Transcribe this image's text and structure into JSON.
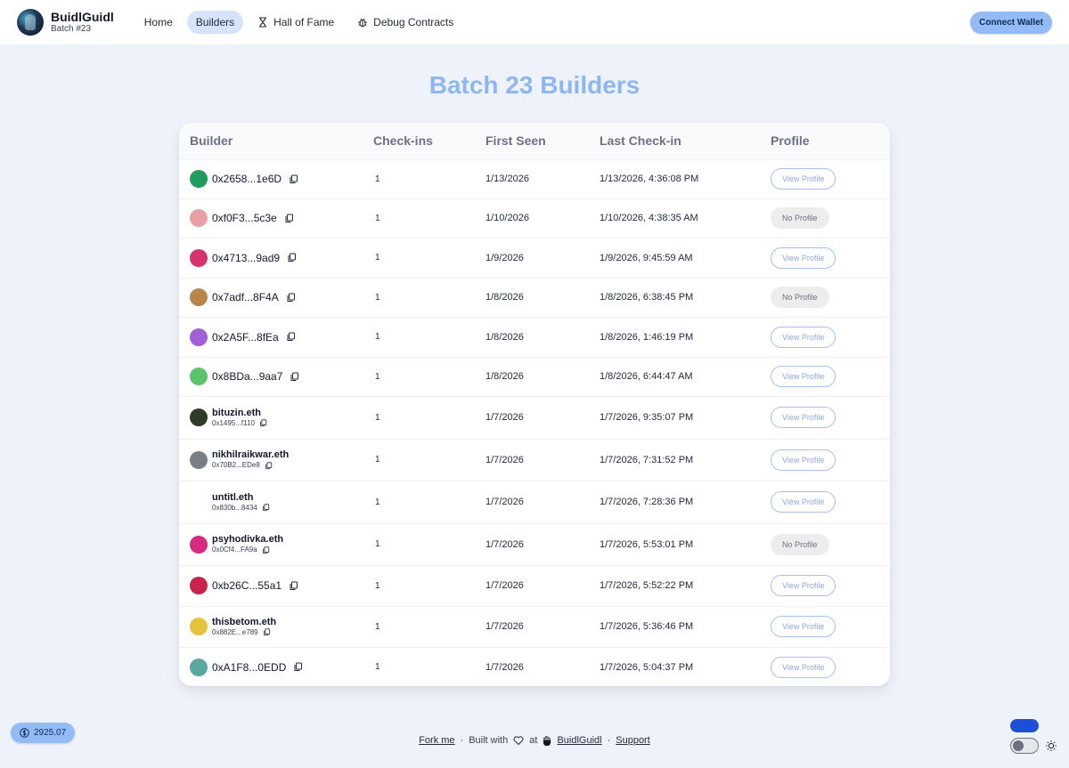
{
  "header": {
    "brand_name": "BuidlGuidl",
    "brand_sub": "Batch #23",
    "nav": [
      {
        "label": "Home",
        "icon": null,
        "active": false
      },
      {
        "label": "Builders",
        "icon": null,
        "active": true
      },
      {
        "label": "Hall of Fame",
        "icon": "hourglass-icon",
        "active": false
      },
      {
        "label": "Debug Contracts",
        "icon": "bug-icon",
        "active": false
      }
    ],
    "connect_label": "Connect Wallet"
  },
  "page_title": "Batch 23 Builders",
  "table": {
    "columns": [
      "Builder",
      "Check-ins",
      "First Seen",
      "Last Check-in",
      "Profile"
    ],
    "rows": [
      {
        "name": "",
        "address": "0x2658...1e6D",
        "checkins": "1",
        "first_seen": "1/13/2026",
        "last_checkin": "1/13/2026, 4:36:08 PM",
        "profile": "View Profile",
        "has_profile": true,
        "avatar": "#1f9d5c"
      },
      {
        "name": "",
        "address": "0xf0F3...5c3e",
        "checkins": "1",
        "first_seen": "1/10/2026",
        "last_checkin": "1/10/2026, 4:38:35 AM",
        "profile": "No Profile",
        "has_profile": false,
        "avatar": "#e8a0a6"
      },
      {
        "name": "",
        "address": "0x4713...9ad9",
        "checkins": "1",
        "first_seen": "1/9/2026",
        "last_checkin": "1/9/2026, 9:45:59 AM",
        "profile": "View Profile",
        "has_profile": true,
        "avatar": "#d6336c"
      },
      {
        "name": "",
        "address": "0x7adf...8F4A",
        "checkins": "1",
        "first_seen": "1/8/2026",
        "last_checkin": "1/8/2026, 6:38:45 PM",
        "profile": "No Profile",
        "has_profile": false,
        "avatar": "#b8864b"
      },
      {
        "name": "",
        "address": "0x2A5F...8fEa",
        "checkins": "1",
        "first_seen": "1/8/2026",
        "last_checkin": "1/8/2026, 1:46:19 PM",
        "profile": "View Profile",
        "has_profile": true,
        "avatar": "#a35fd6"
      },
      {
        "name": "",
        "address": "0x8BDa...9aa7",
        "checkins": "1",
        "first_seen": "1/8/2026",
        "last_checkin": "1/8/2026, 6:44:47 AM",
        "profile": "View Profile",
        "has_profile": true,
        "avatar": "#5cc46a"
      },
      {
        "name": "bituzin.eth",
        "address": "0x1495...f110",
        "checkins": "1",
        "first_seen": "1/7/2026",
        "last_checkin": "1/7/2026, 9:35:07 PM",
        "profile": "View Profile",
        "has_profile": true,
        "avatar": "#2f3a2a"
      },
      {
        "name": "nikhilraikwar.eth",
        "address": "0x70B2...EDe8",
        "checkins": "1",
        "first_seen": "1/7/2026",
        "last_checkin": "1/7/2026, 7:31:52 PM",
        "profile": "View Profile",
        "has_profile": true,
        "avatar": "#7a7f86"
      },
      {
        "name": "untitl.eth",
        "address": "0x830b...8434",
        "checkins": "1",
        "first_seen": "1/7/2026",
        "last_checkin": "1/7/2026, 7:28:36 PM",
        "profile": "View Profile",
        "has_profile": true,
        "avatar": "#ffffff"
      },
      {
        "name": "psyhodivka.eth",
        "address": "0x0Cf4...FA9a",
        "checkins": "1",
        "first_seen": "1/7/2026",
        "last_checkin": "1/7/2026, 5:53:01 PM",
        "profile": "No Profile",
        "has_profile": false,
        "avatar": "#d8287f"
      },
      {
        "name": "",
        "address": "0xb26C...55a1",
        "checkins": "1",
        "first_seen": "1/7/2026",
        "last_checkin": "1/7/2026, 5:52:22 PM",
        "profile": "View Profile",
        "has_profile": true,
        "avatar": "#c8234a"
      },
      {
        "name": "thisbetom.eth",
        "address": "0x882E...e789",
        "checkins": "1",
        "first_seen": "1/7/2026",
        "last_checkin": "1/7/2026, 5:36:46 PM",
        "profile": "View Profile",
        "has_profile": true,
        "avatar": "#e6c13a"
      },
      {
        "name": "",
        "address": "0xA1F8...0EDD",
        "checkins": "1",
        "first_seen": "1/7/2026",
        "last_checkin": "1/7/2026, 5:04:37 PM",
        "profile": "View Profile",
        "has_profile": true,
        "avatar": "#5aa8a0"
      }
    ]
  },
  "footer": {
    "fork_label": "Fork me",
    "built_label": "Built with",
    "at_label": "at",
    "brand_link": "BuidlGuidl",
    "support_label": "Support"
  },
  "price_label": "2925.07"
}
